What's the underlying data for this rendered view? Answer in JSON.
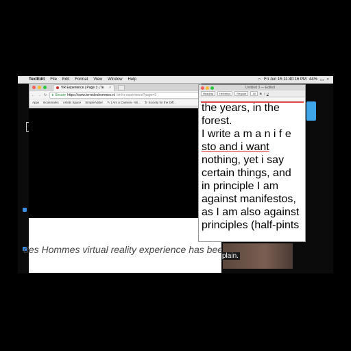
{
  "menubar": {
    "app": "TextEdit",
    "items": [
      "File",
      "Edit",
      "Format",
      "View",
      "Window",
      "Help"
    ],
    "status": {
      "datetime": "Fri Jun 15 11:40:16 PM",
      "battery": "44%"
    }
  },
  "browser": {
    "tab_title": "VR Experience | Page 3 | Te",
    "url_secure": "Secure",
    "url_host": "https://www.terredeshommes.nl",
    "url_path": "/en/vr-experience?page=3",
    "bookmarks": [
      "Apps",
      "Bookmarks",
      "Artists Space",
      "SimpleAdder",
      "'A' | Am a Camera - Wi...",
      "'b' Society for the Diff..."
    ]
  },
  "overlay": {
    "text": "des Hommes virtual reality experience has been"
  },
  "desktop": {
    "right_word": "plain."
  },
  "textedit": {
    "window_title": "Untitled 3 — Edited",
    "toolbar": {
      "style": "Heading",
      "font": "Helvetica",
      "weight": "Regular",
      "size": "18"
    },
    "lines": [
      "the years, in the",
      "forest.",
      "I write a m a n i f e",
      "sto and i want",
      "nothing, yet i say",
      "certain things, and",
      "in principle I am",
      "against manifestos,",
      "as I am also against",
      "principles (half-pints"
    ]
  }
}
